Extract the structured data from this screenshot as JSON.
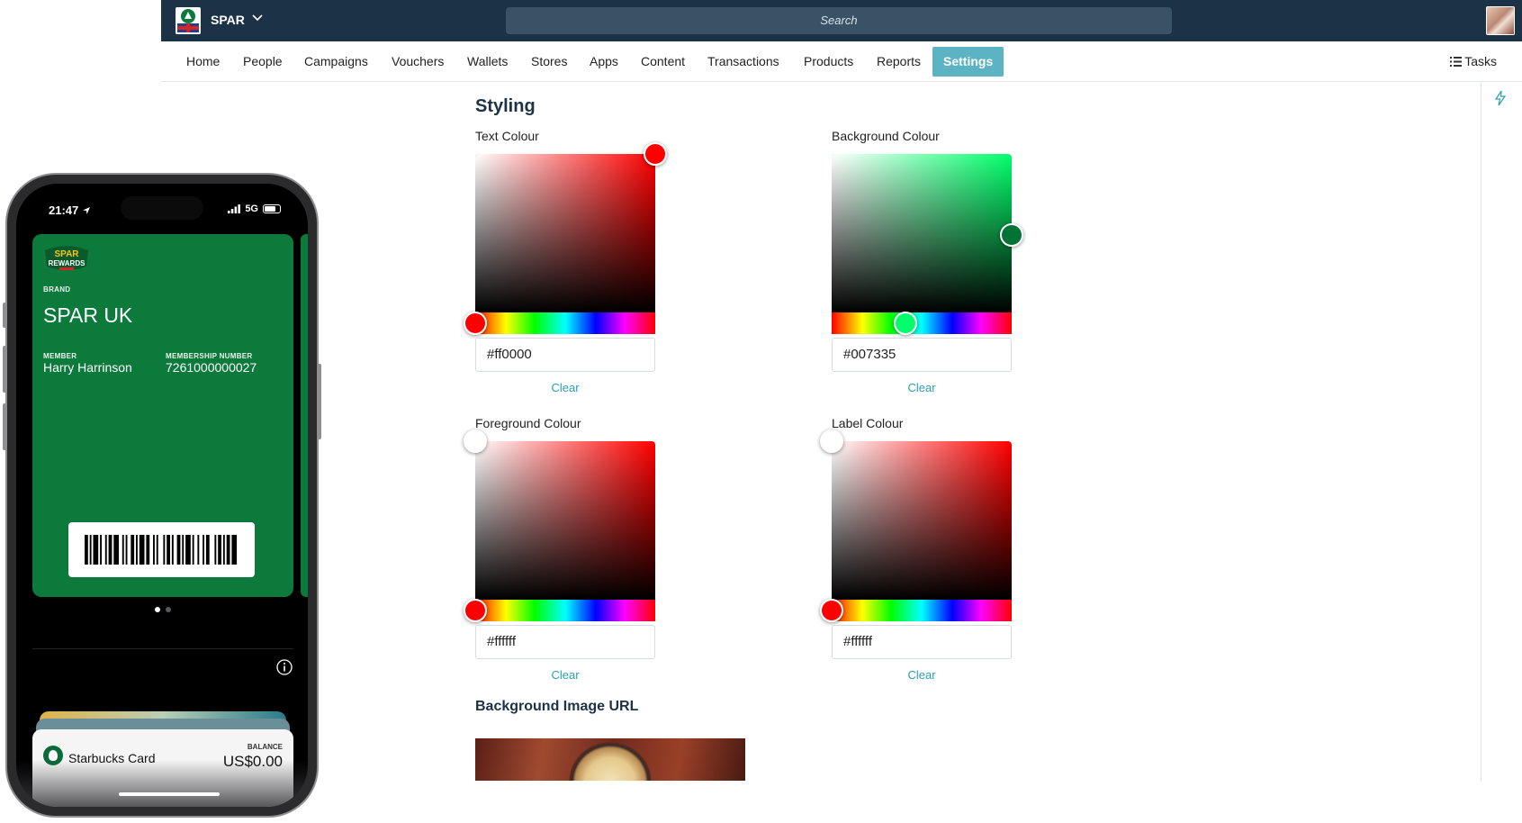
{
  "topbar": {
    "brand": "SPAR",
    "search_placeholder": "Search"
  },
  "nav": {
    "items": [
      "Home",
      "People",
      "Campaigns",
      "Vouchers",
      "Wallets",
      "Stores",
      "Apps",
      "Content",
      "Transactions",
      "Products",
      "Reports",
      "Settings"
    ],
    "active": "Settings",
    "tasks": "Tasks"
  },
  "styling": {
    "title": "Styling",
    "pickers": [
      {
        "label": "Text Colour",
        "value": "#ff0000",
        "clear": "Clear",
        "hue_color": "#ff0000",
        "handle_color": "#ff0000",
        "hue_handle_color": "#ff0000"
      },
      {
        "label": "Background Colour",
        "value": "#007335",
        "clear": "Clear",
        "hue_color": "#00ff6a",
        "handle_color": "#007335",
        "hue_handle_color": "#00ff6a"
      },
      {
        "label": "Foreground Colour",
        "value": "#ffffff",
        "clear": "Clear",
        "hue_color": "#ff0000",
        "handle_color": "#ffffff",
        "hue_handle_color": "#ff0000"
      },
      {
        "label": "Label Colour",
        "value": "#ffffff",
        "clear": "Clear",
        "hue_color": "#ff0000",
        "handle_color": "#ffffff",
        "hue_handle_color": "#ff0000"
      }
    ],
    "background_image_title": "Background Image URL"
  },
  "phone": {
    "time": "21:47",
    "network": "5G",
    "card": {
      "logo_line1": "SPAR",
      "logo_line2": "REWARDS",
      "brand_label": "BRAND",
      "brand_value": "SPAR UK",
      "member_label": "MEMBER",
      "member_value": "Harry Harrinson",
      "number_label": "MEMBERSHIP NUMBER",
      "number_value": "7261000000027",
      "color": "#0b7a3b"
    },
    "starbucks": {
      "name": "Starbucks Card",
      "balance_label": "BALANCE",
      "balance_value": "US$0.00"
    }
  },
  "icons": {
    "brand_chevron": "chevron-down-icon",
    "tasks": "list-icon",
    "rail": "bolt-icon",
    "info": "info-icon"
  }
}
